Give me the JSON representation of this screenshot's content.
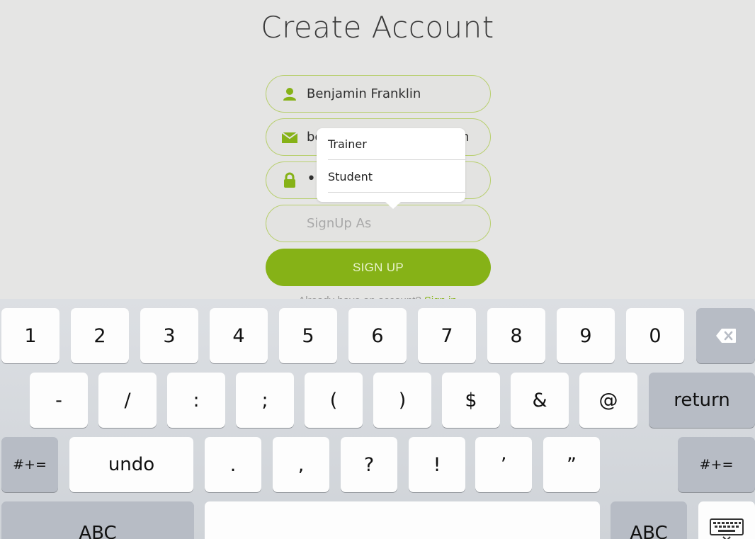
{
  "title": "Create Account",
  "form": {
    "name_value": "Benjamin Franklin",
    "email_value": "be",
    "email_tail": "n",
    "password_value": "•",
    "role_placeholder": "SignUp As",
    "signup_label": "SIGN UP",
    "signin_prompt": "Already have an account?",
    "signin_link": "Sign in"
  },
  "role_popover": {
    "options": [
      "Trainer",
      "Student"
    ]
  },
  "keyboard": {
    "row1": [
      "1",
      "2",
      "3",
      "4",
      "5",
      "6",
      "7",
      "8",
      "9",
      "0"
    ],
    "row2": [
      "-",
      "/",
      ":",
      ";",
      "(",
      ")",
      "$",
      "&",
      "@"
    ],
    "return_label": "return",
    "row3_left": "#+=",
    "undo_label": "undo",
    "row3": [
      ".",
      ",",
      "?",
      "!",
      "’",
      "”"
    ],
    "row3_right": "#+=",
    "abc_left": "ABC",
    "abc_right": "ABC"
  },
  "colors": {
    "accent": "#86b217",
    "field_border": "#b8cf6e",
    "background": "#e5e5e4"
  },
  "icons": [
    "user-icon",
    "mail-icon",
    "lock-icon",
    "backspace-icon",
    "keyboard-dismiss-icon"
  ]
}
